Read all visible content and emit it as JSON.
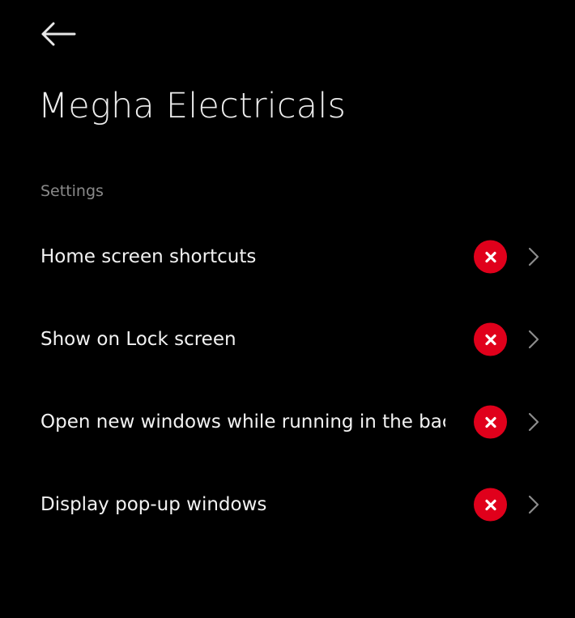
{
  "header": {
    "back_icon": "arrow-left-icon",
    "title": "Megha Electricals"
  },
  "section": {
    "label": "Settings"
  },
  "settings": [
    {
      "label": "Home screen shortcuts",
      "status": "denied",
      "status_icon": "red-x-circle-icon",
      "nav_icon": "chevron-right-icon"
    },
    {
      "label": "Show on Lock screen",
      "status": "denied",
      "status_icon": "red-x-circle-icon",
      "nav_icon": "chevron-right-icon"
    },
    {
      "label": "Open new windows while running in the bac..",
      "status": "denied",
      "status_icon": "red-x-circle-icon",
      "nav_icon": "chevron-right-icon"
    },
    {
      "label": "Display pop-up windows",
      "status": "denied",
      "status_icon": "red-x-circle-icon",
      "nav_icon": "chevron-right-icon"
    }
  ],
  "colors": {
    "background": "#000000",
    "title_text": "#ededed",
    "row_text": "#f2f2f2",
    "section_text": "#8a8a8a",
    "denied_badge": "#e0001b",
    "chevron": "#8c8c8c"
  }
}
